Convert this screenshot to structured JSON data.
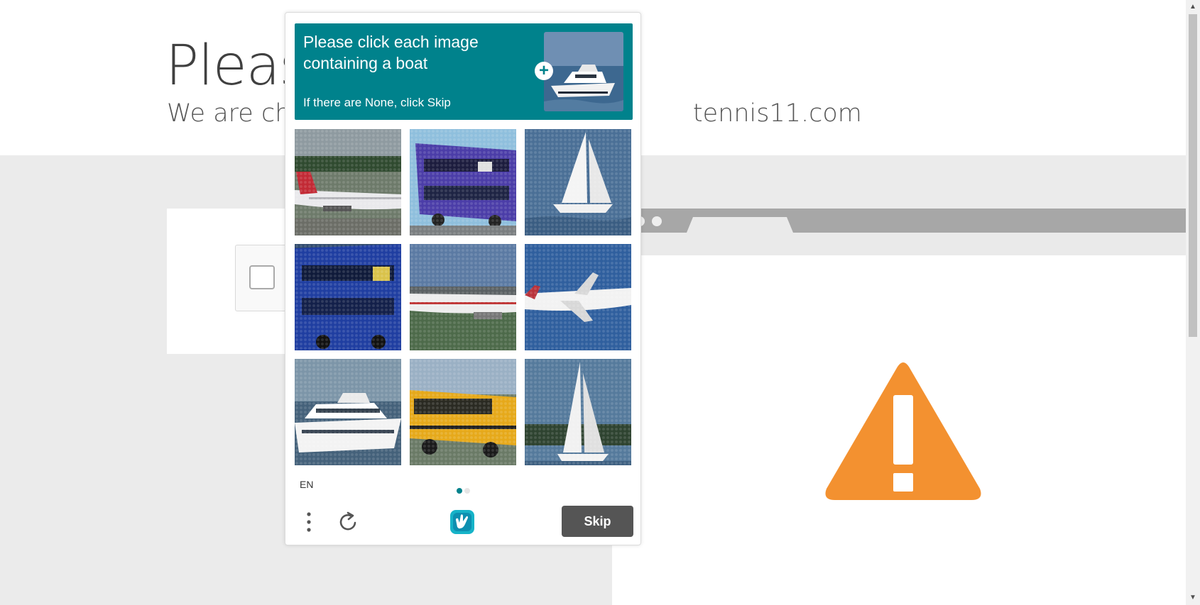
{
  "page": {
    "title": "Please",
    "subtitle": "We are che",
    "subtitle_tail": "tennis11.com"
  },
  "captcha": {
    "prompt": "Please click each image containing a boat",
    "hint": "If there are None, click Skip",
    "language": "EN",
    "skip_label": "Skip",
    "pager": {
      "current": 1,
      "total": 2
    },
    "accent_color": "#00828c",
    "tiles": [
      {
        "subject": "airplane"
      },
      {
        "subject": "blue double-decker bus"
      },
      {
        "subject": "sailboat"
      },
      {
        "subject": "blue double-decker bus"
      },
      {
        "subject": "airplane"
      },
      {
        "subject": "airplane"
      },
      {
        "subject": "yacht"
      },
      {
        "subject": "yellow school bus"
      },
      {
        "subject": "sailboat"
      }
    ]
  },
  "icons": {
    "menu": "vertical-dots-icon",
    "refresh": "refresh-icon",
    "logo": "hcaptcha-logo",
    "warning": "warning-triangle-icon"
  },
  "colors": {
    "warning": "#f39130",
    "skip_button": "#555555",
    "gray_area": "#ebebeb"
  }
}
